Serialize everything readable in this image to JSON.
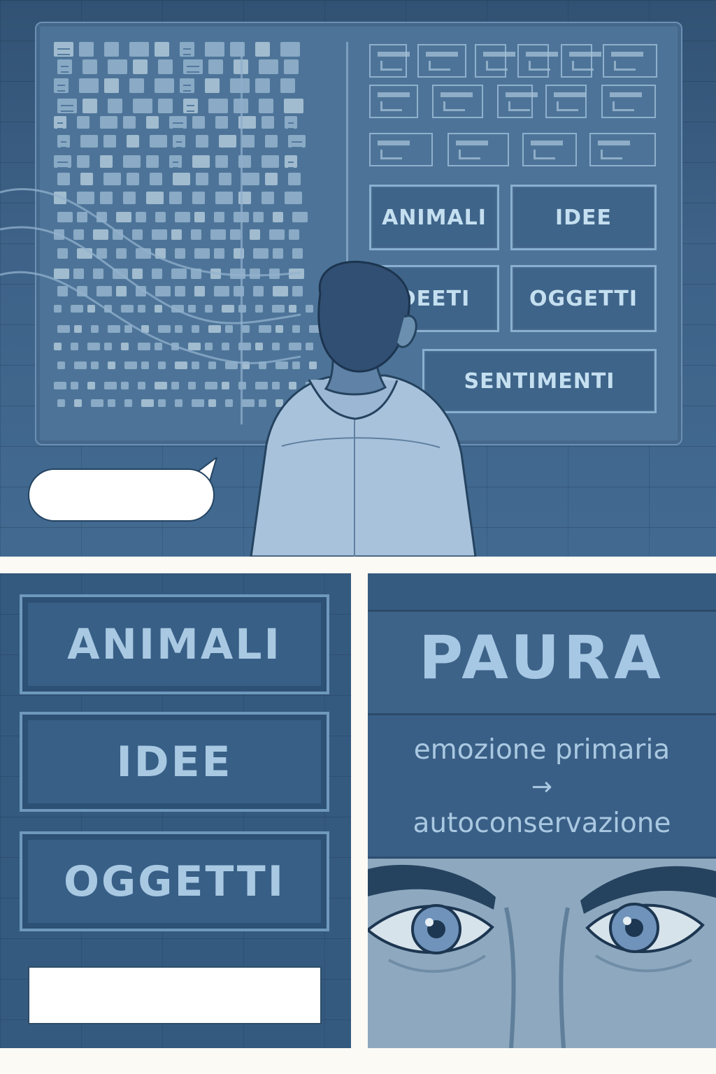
{
  "top_panel": {
    "categories": [
      {
        "label": "ANIMALI"
      },
      {
        "label": "IDEE"
      },
      {
        "label": "DEETI"
      },
      {
        "label": "OGGETTI"
      },
      {
        "label": "SENTIMENTI"
      }
    ],
    "speech_bubble_text": ""
  },
  "left_panel": {
    "categories": [
      {
        "label": "ANIMALI"
      },
      {
        "label": "IDEE"
      },
      {
        "label": "OGGETTI"
      }
    ],
    "caption_text": ""
  },
  "right_panel": {
    "title": "PAURA",
    "definition_line_1": "emozione primaria",
    "arrow": "→",
    "definition_line_2": "autoconservazione"
  },
  "colors": {
    "page_background": "#fbfaf4",
    "panel_blue": "#3f6388",
    "screen_blue": "#4d7498",
    "label_blue": "#c4dff0",
    "outline_blue": "#8ab0d0"
  }
}
